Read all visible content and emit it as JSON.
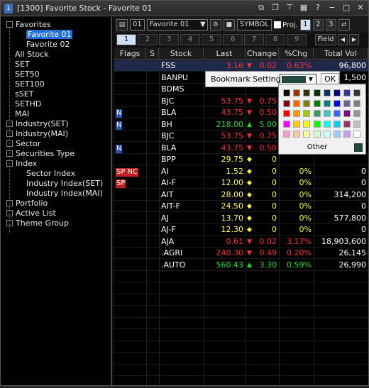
{
  "window": {
    "title": "[1300] Favorite Stock - Favorite 01",
    "icon_label": "1"
  },
  "tree": [
    {
      "label": "Favorites",
      "expander": true
    },
    {
      "label": "Favorite 01",
      "selected": true
    },
    {
      "label": "Favorite 02"
    },
    {
      "label": "All Stock"
    },
    {
      "label": "SET"
    },
    {
      "label": "SET50"
    },
    {
      "label": "SET100"
    },
    {
      "label": "sSET"
    },
    {
      "label": "SETHD"
    },
    {
      "label": "MAI"
    },
    {
      "label": "Industry(SET)",
      "expander": true
    },
    {
      "label": "Industry(MAI)",
      "expander": true
    },
    {
      "label": "Sector",
      "expander": true
    },
    {
      "label": "Securities Type",
      "expander": true
    },
    {
      "label": "Index",
      "expander": true
    },
    {
      "label": "Sector Index"
    },
    {
      "label": "Industry Index(SET)"
    },
    {
      "label": "Industry Index(MAI)"
    },
    {
      "label": "Portfolio",
      "expander": true
    },
    {
      "label": "Active List",
      "expander": true
    },
    {
      "label": "Theme Group",
      "expander": true
    }
  ],
  "toolbar": {
    "number": "01",
    "favorite_select": "Favorite 01",
    "symbol_label": "SYMBOL",
    "proj_label": "Proj.",
    "page_buttons": [
      "1",
      "2",
      "3"
    ]
  },
  "tabs": [
    "1",
    "2",
    "3",
    "4",
    "5",
    "6",
    "7",
    "8",
    "9"
  ],
  "field_label": "Field",
  "columns": [
    "Flags",
    "S",
    "Stock",
    "Last",
    "Change",
    "%Chg",
    "Total Vol"
  ],
  "rows": [
    {
      "flags": "",
      "stock": "FSS",
      "last": "3.16",
      "arrow": "▼",
      "change": "0.02",
      "pct": "0.63%",
      "vol": "96,800",
      "color": "red",
      "highlight": true
    },
    {
      "flags": "",
      "stock": "BANPU",
      "last": "",
      "arrow": "",
      "change": "",
      "pct": "",
      "vol": "1,500",
      "color": "white"
    },
    {
      "flags": "",
      "stock": "BDMS",
      "last": "",
      "arrow": "",
      "change": "",
      "pct": "",
      "vol": "",
      "color": "white"
    },
    {
      "flags": "",
      "stock": "BJC",
      "last": "53.75",
      "arrow": "▼",
      "change": "0.75",
      "pct": "",
      "vol": "",
      "color": "red"
    },
    {
      "flags": "N",
      "stock": "BLA",
      "last": "43.75",
      "arrow": "▼",
      "change": "0.50",
      "pct": "",
      "vol": "",
      "color": "red"
    },
    {
      "flags": "N",
      "stock": "BH",
      "last": "218.00",
      "arrow": "▲",
      "change": "5.00",
      "pct": "",
      "vol": "",
      "color": "green"
    },
    {
      "flags": "",
      "stock": "BJC",
      "last": "53.75",
      "arrow": "▼",
      "change": "0.75",
      "pct": "",
      "vol": "",
      "color": "red"
    },
    {
      "flags": "N",
      "stock": "BLA",
      "last": "43.75",
      "arrow": "▼",
      "change": "0.50",
      "pct": "",
      "vol": "",
      "color": "red"
    },
    {
      "flags": "",
      "stock": "BPP",
      "last": "29.75",
      "arrow": "◆",
      "change": "0",
      "pct": "",
      "vol": "",
      "color": "yellow"
    },
    {
      "flags": "SP NC",
      "stock": "AI",
      "last": "1.52",
      "arrow": "◆",
      "change": "0",
      "pct": "0%",
      "vol": "0",
      "color": "yellow"
    },
    {
      "flags": "SP",
      "stock": "AI-F",
      "last": "12.00",
      "arrow": "◆",
      "change": "0",
      "pct": "0%",
      "vol": "0",
      "color": "yellow"
    },
    {
      "flags": "",
      "stock": "AIT",
      "last": "28.00",
      "arrow": "◆",
      "change": "0",
      "pct": "0%",
      "vol": "314,200",
      "color": "yellow"
    },
    {
      "flags": "",
      "stock": "AIT-F",
      "last": "24.50",
      "arrow": "◆",
      "change": "0",
      "pct": "0%",
      "vol": "0",
      "color": "yellow"
    },
    {
      "flags": "",
      "stock": "AJ",
      "last": "13.70",
      "arrow": "◆",
      "change": "0",
      "pct": "0%",
      "vol": "577,800",
      "color": "yellow"
    },
    {
      "flags": "",
      "stock": "AJ-F",
      "last": "12.30",
      "arrow": "◆",
      "change": "0",
      "pct": "0%",
      "vol": "0",
      "color": "yellow"
    },
    {
      "flags": "",
      "stock": "AJA",
      "last": "0.61",
      "arrow": "▼",
      "change": "0.02",
      "pct": "3.17%",
      "vol": "18,903,600",
      "color": "red"
    },
    {
      "flags": "",
      "stock": ".AGRI",
      "last": "240.30",
      "arrow": "▼",
      "change": "0.49",
      "pct": "0.20%",
      "vol": "26,145",
      "color": "red"
    },
    {
      "flags": "",
      "stock": ".AUTO",
      "last": "560.43",
      "arrow": "▲",
      "change": "3.30",
      "pct": "0.59%",
      "vol": "26,990",
      "color": "green"
    }
  ],
  "popup": {
    "label": "Bookmark Settings",
    "ok": "OK",
    "other": "Other",
    "selected_color": "#1e4a40"
  },
  "palette": [
    [
      "#000000",
      "#993300",
      "#333300",
      "#003300",
      "#003366",
      "#000080",
      "#333399",
      "#333333"
    ],
    [
      "#800000",
      "#ff6600",
      "#808000",
      "#008000",
      "#008080",
      "#0000ff",
      "#666699",
      "#808080"
    ],
    [
      "#ff0000",
      "#ff9900",
      "#99cc00",
      "#339966",
      "#33cccc",
      "#3366ff",
      "#800080",
      "#969696"
    ],
    [
      "#ff00ff",
      "#ffcc00",
      "#ffff00",
      "#00ff00",
      "#00ffff",
      "#00ccff",
      "#993366",
      "#c0c0c0"
    ],
    [
      "#ff99cc",
      "#ffcc99",
      "#ffff99",
      "#ccffcc",
      "#ccffff",
      "#99ccff",
      "#cc99ff",
      "#ffffff"
    ]
  ]
}
